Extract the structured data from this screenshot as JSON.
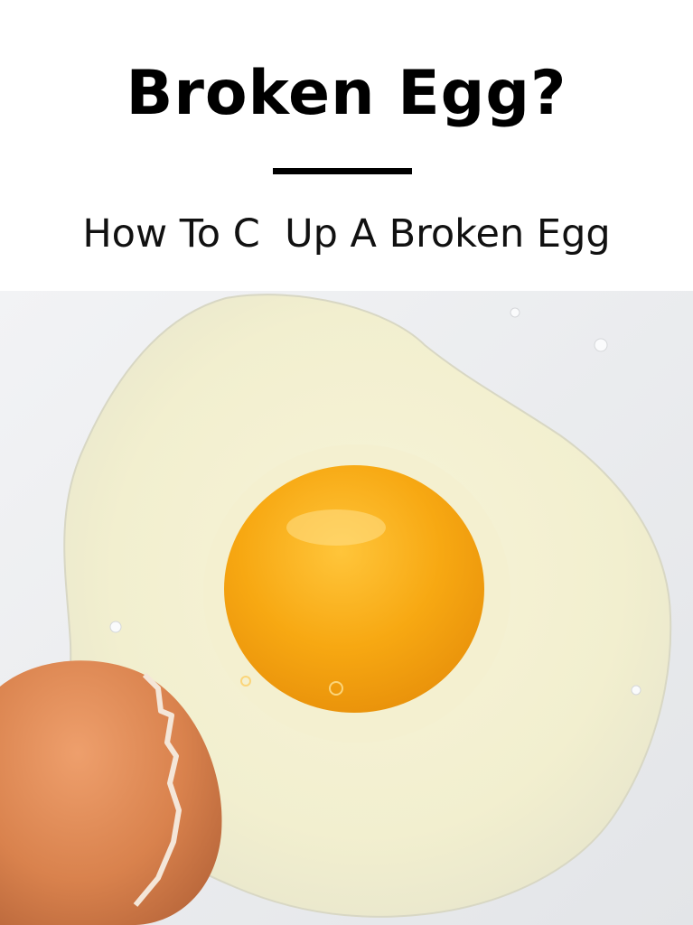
{
  "header": {
    "title": "Broken Egg?",
    "subtitle": "How To C  Up A Broken Egg"
  },
  "photo": {
    "description_icon": "cracked-egg-photo",
    "colors": {
      "background": "#eceef0",
      "egg_white": "#f4f1d2",
      "yolk": "#f5a50a",
      "shell": "#d98a58"
    }
  }
}
